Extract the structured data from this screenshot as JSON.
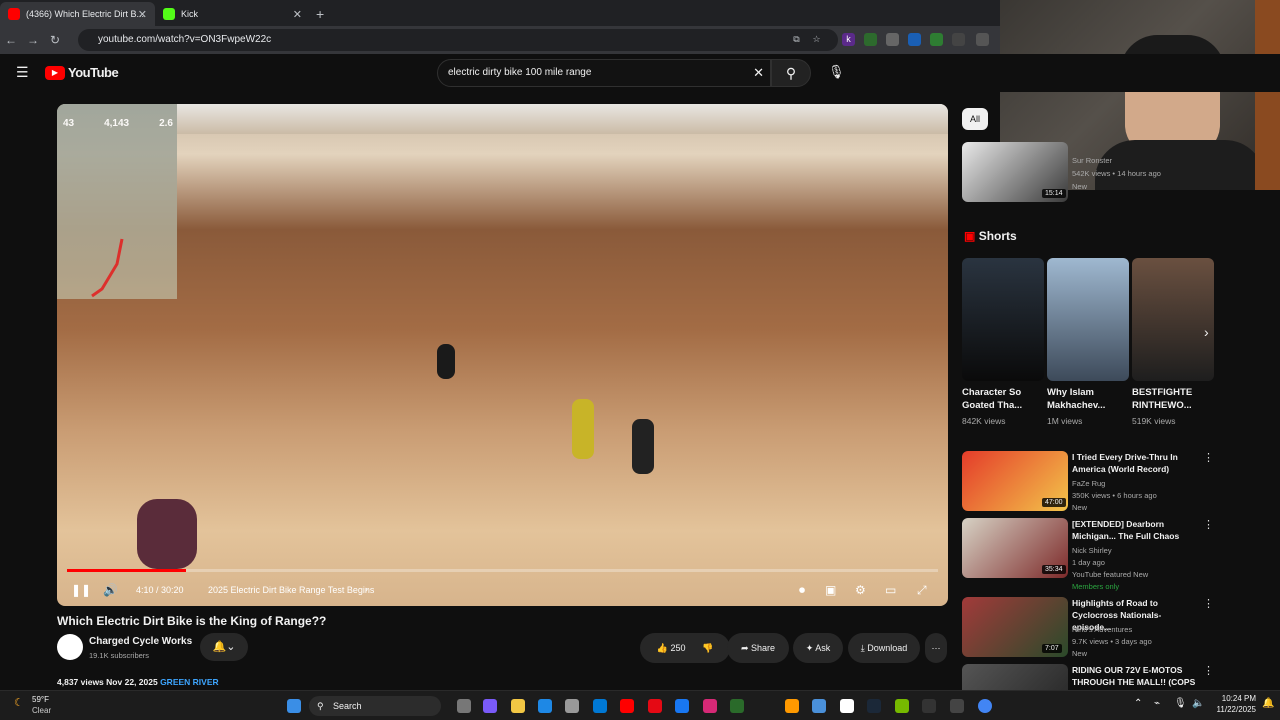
{
  "browser": {
    "tabs": [
      {
        "title": "(4366) Which Electric Dirt B...",
        "favicon_color": "#ff0000"
      },
      {
        "title": "Kick",
        "favicon_color": "#53fc18"
      }
    ],
    "url": "youtube.com/watch?v=ON3FwpeW22c"
  },
  "youtube": {
    "logo_text": "YouTube",
    "search_value": "electric dirty bike 100 mile range"
  },
  "player": {
    "time": "4:10 / 30:20",
    "chapter": "2025 Electric Dirt Bike Range Test Begins",
    "progress": 0.137,
    "overlay_stats": [
      "43",
      "4,143",
      "2.6"
    ]
  },
  "video_meta": {
    "title": "Which Electric Dirt Bike is the King of Range??",
    "channel": "Charged Cycle Works",
    "subscribers": "19.1K subscribers",
    "likes": "250",
    "share": "Share",
    "ask": "Ask",
    "download": "Download",
    "views": "4,837 views",
    "date": "Nov 22, 2025",
    "tag": "GREEN RIVER"
  },
  "sidebar": {
    "filter_all": "All",
    "shorts_label": "Shorts",
    "top_video": {
      "channel": "Sur Ronster",
      "stats": "542K views • 14 hours ago",
      "badge": "New",
      "duration": "15:14"
    },
    "shorts": [
      {
        "title": "Character So Goated Tha...",
        "views": "842K views"
      },
      {
        "title": "Why Islam Makhachev...",
        "views": "1M views"
      },
      {
        "title": "BESTFIGHTE RINTHEWO...",
        "views": "519K views"
      }
    ],
    "videos": [
      {
        "title": "I Tried Every Drive-Thru In America (World Record)",
        "channel": "FaZe Rug",
        "stats": "350K views • 6 hours ago",
        "badge": "New",
        "duration": "47:00"
      },
      {
        "title": "[EXTENDED] Dearborn Michigan... The Full Chaos",
        "channel": "Nick Shirley",
        "stats": "1 day ago",
        "badge": "YouTube featured   New",
        "extra": "Members only",
        "duration": "35:34"
      },
      {
        "title": "Highlights of Road to Cyclocross Nationals- episode...",
        "channel": "Nino's Adventures",
        "stats": "9.7K views • 3 days ago",
        "badge": "New",
        "duration": "7:07"
      },
      {
        "title": "RIDING OUR 72V E-MOTOS THROUGH THE MALL!! (COPS ...",
        "channel": "",
        "stats": "",
        "badge": "",
        "duration": ""
      }
    ]
  },
  "taskbar": {
    "weather_temp": "59°F",
    "weather_desc": "Clear",
    "search": "Search",
    "time": "10:24 PM",
    "date": "11/22/2025"
  }
}
